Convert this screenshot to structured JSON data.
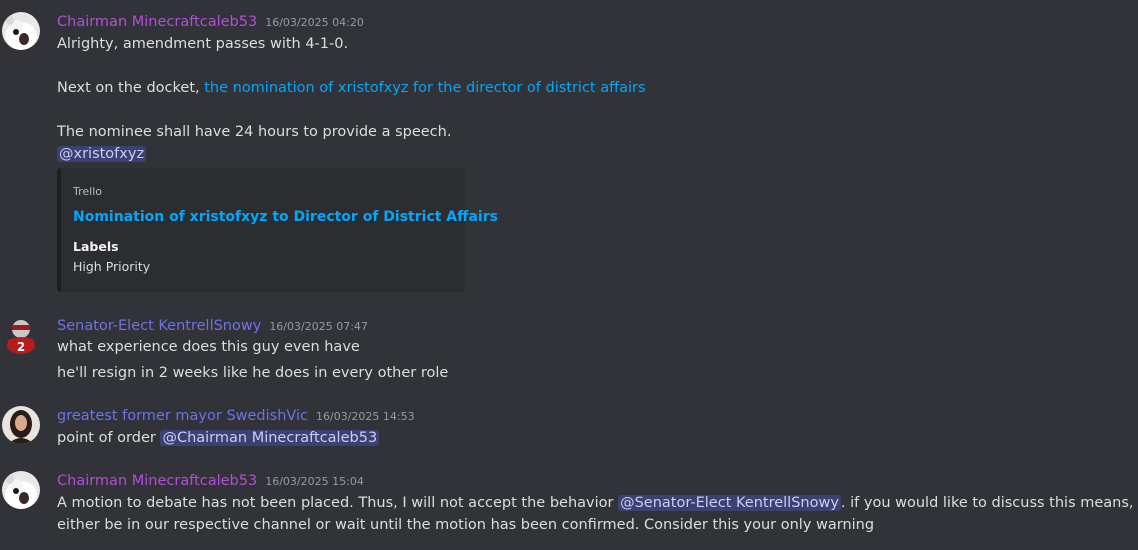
{
  "messages": [
    {
      "author": "Chairman Minecraftcaleb53",
      "timestamp": "16/03/2025 04:20",
      "line1": "Alrighty, amendment passes with 4-1-0.",
      "line2_prefix": "Next on the docket, ",
      "line2_link": "the nomination of xristofxyz for the director of district affairs",
      "line3": "The nominee shall have 24 hours to provide a speech.",
      "mention": "@xristofxyz",
      "embed": {
        "provider": "Trello",
        "title": "Nomination of xristofxyz to Director of District Affairs",
        "field_name": "Labels",
        "field_value": "High Priority"
      }
    },
    {
      "author": "Senator-Elect KentrellSnowy",
      "timestamp": "16/03/2025 07:47",
      "line1": "what experience does this guy even have",
      "line2": "he'll resign in 2 weeks like he does in every other role"
    },
    {
      "author": "greatest former mayor SwedishVic",
      "timestamp": "16/03/2025 14:53",
      "line1_prefix": "point of order ",
      "mention": "@Chairman Minecraftcaleb53"
    },
    {
      "author": "Chairman Minecraftcaleb53",
      "timestamp": "16/03/2025 15:04",
      "line1_prefix": "A motion to debate has not been placed. Thus, I will not accept the behavior ",
      "mention": "@Senator-Elect KentrellSnowy",
      "line1_suffix": ". if you would like to discuss this means, it can",
      "line2": "either be in our respective channel or wait until the motion has been confirmed. Consider this your only warning"
    }
  ],
  "colors": {
    "chairman": "#b34fd6",
    "senator": "#6f72e8",
    "swedishvic": "#6f72e8",
    "link": "#00a8fc"
  }
}
